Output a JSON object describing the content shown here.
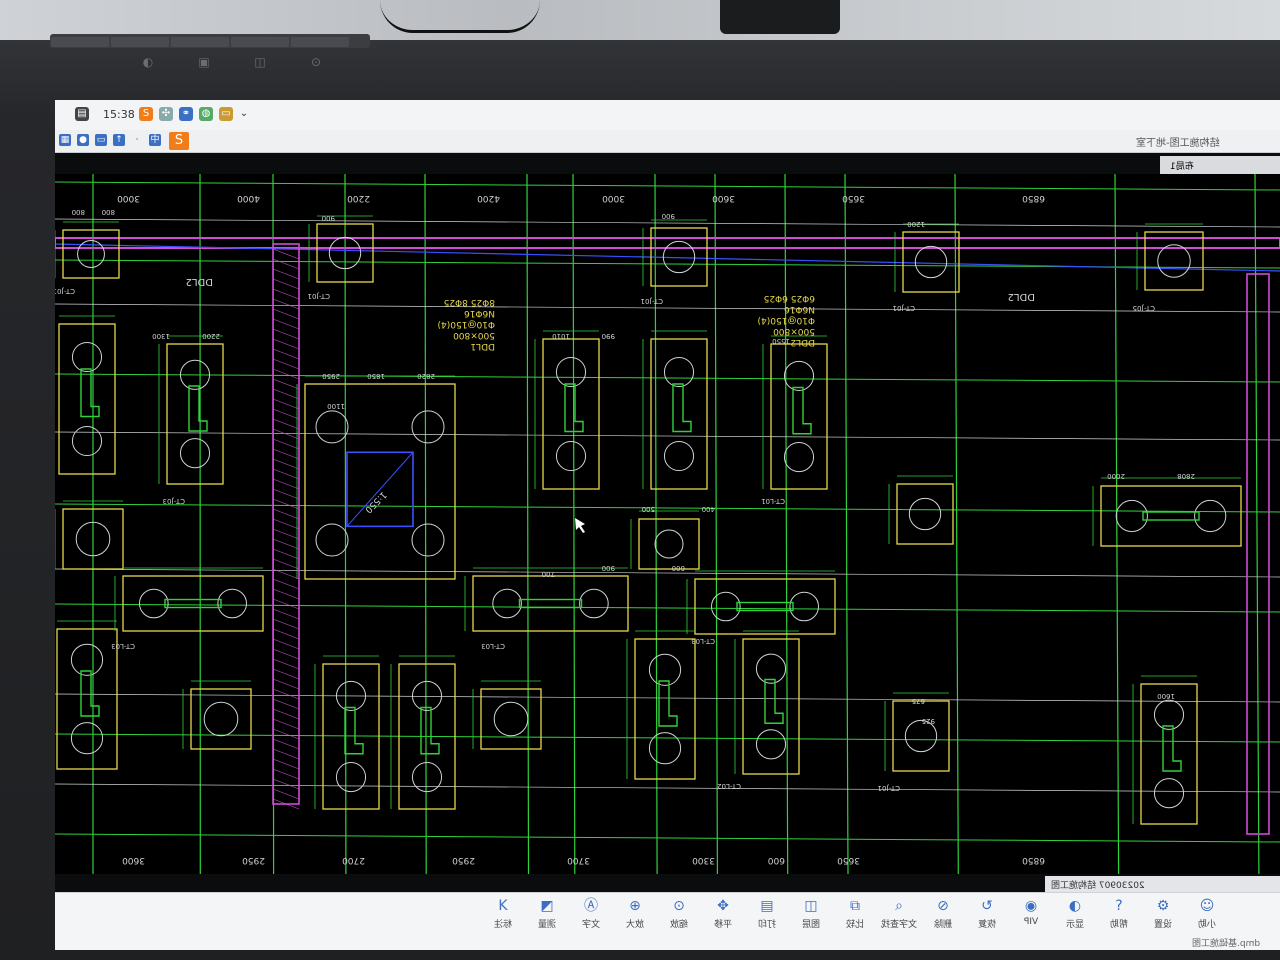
{
  "quick_access": {
    "time": "15:38"
  },
  "document": {
    "tab_title": "结构施工图-地下室",
    "layout_tab": "布局1",
    "file_tab": "20230907 结构施工图",
    "status_path": "dmp.基础施工图"
  },
  "drawing": {
    "top_dims": [
      "3000",
      "4000",
      "2200",
      "4200",
      "3000",
      "3600",
      "3650",
      "6850"
    ],
    "bottom_dims": [
      "3600",
      "2950",
      "2700",
      "2950",
      "3700",
      "3300",
      "600",
      "3650",
      "6850"
    ],
    "beam_labels": [
      "DDL2",
      "DDL2"
    ],
    "beam_note": [
      "DDL1",
      "500×800",
      "Φ10@150(4)",
      "N6Φ16",
      "8Φ25 8Φ25"
    ],
    "beam_note2": [
      "DDL2",
      "500×800",
      "Φ10@150(4)",
      "N6Φ16",
      "6Φ25 6Φ25"
    ],
    "cap_labels": [
      "CT-J01",
      "CT-J01",
      "CT-J01",
      "CT-J01",
      "CT-J05",
      "CT-J03",
      "CT-L03",
      "CT-L03",
      "CT-L03",
      "CT-L02",
      "CT-L01",
      "CT-J01"
    ],
    "dim_values": [
      "800",
      "800",
      "900",
      "900",
      "1200",
      "1300",
      "2200",
      "1010",
      "990",
      "1550",
      "2950",
      "1850",
      "2820",
      "1100",
      "600",
      "900",
      "700",
      "500",
      "400",
      "2000",
      "2808",
      "1600",
      "675",
      "925"
    ],
    "slope_label": "1:550"
  },
  "ribbon": {
    "buttons": [
      {
        "label": "标注",
        "icon": "annotate-icon"
      },
      {
        "label": "测量",
        "icon": "measure-icon"
      },
      {
        "label": "文字",
        "icon": "text-icon"
      },
      {
        "label": "放大",
        "icon": "zoom-in-icon"
      },
      {
        "label": "缩放",
        "icon": "zoom-icon"
      },
      {
        "label": "平移",
        "icon": "pan-icon"
      },
      {
        "label": "打印",
        "icon": "print-icon"
      },
      {
        "label": "图层",
        "icon": "layer-icon"
      },
      {
        "label": "比较",
        "icon": "compare-icon"
      },
      {
        "label": "文字查找",
        "icon": "find-icon"
      },
      {
        "label": "删除",
        "icon": "delete-icon"
      },
      {
        "label": "恢复",
        "icon": "restore-icon"
      },
      {
        "label": "VIP",
        "icon": "vip-icon"
      },
      {
        "label": "显示",
        "icon": "display-icon"
      },
      {
        "label": "帮助",
        "icon": "help-icon"
      },
      {
        "label": "设置",
        "icon": "settings-icon"
      },
      {
        "label": "小助",
        "icon": "assistant-icon"
      }
    ]
  },
  "colors": {
    "grid_green": "#30d23a",
    "grid_white": "#cfd3d6",
    "cap_yellow": "#e6d84a",
    "magenta": "#d04cd6",
    "blue": "#3a50ff",
    "cad_bg": "#000000"
  }
}
